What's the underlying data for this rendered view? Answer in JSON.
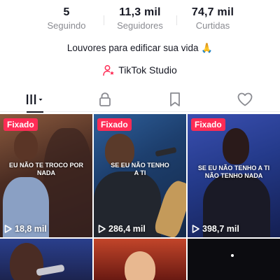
{
  "profile": {
    "stats": {
      "seguindo_count": "5",
      "seguindo_label": "Seguindo",
      "seguidores_count": "11,3 mil",
      "seguidores_label": "Seguidores",
      "curtidas_count": "74,7 mil",
      "curtidas_label": "Curtidas"
    },
    "bio": "Louvores para edificar sua vida 🙏",
    "studio_label": "TikTok Studio"
  },
  "tabs": [
    {
      "icon": "videos-grid-icon",
      "active": true
    },
    {
      "icon": "lock-icon",
      "active": false
    },
    {
      "icon": "bookmark-icon",
      "active": false
    },
    {
      "icon": "heart-icon",
      "active": false
    }
  ],
  "videos": [
    {
      "badge": "Fixado",
      "caption": "EU NÃO TE TROCO POR NADA",
      "views": "18,8 mil"
    },
    {
      "badge": "Fixado",
      "caption": "SE EU NÃO TENHO A TI",
      "views": "286,4 mil"
    },
    {
      "badge": "Fixado",
      "caption": "SE EU NÃO TENHO A TI NÃO TENHO NADA",
      "views": "398,7 mil"
    },
    {},
    {},
    {}
  ],
  "colors": {
    "badge": "#fe2c55",
    "text_primary": "#161823",
    "text_secondary": "#8a8b91",
    "studio_icon": "#fe2c55"
  }
}
